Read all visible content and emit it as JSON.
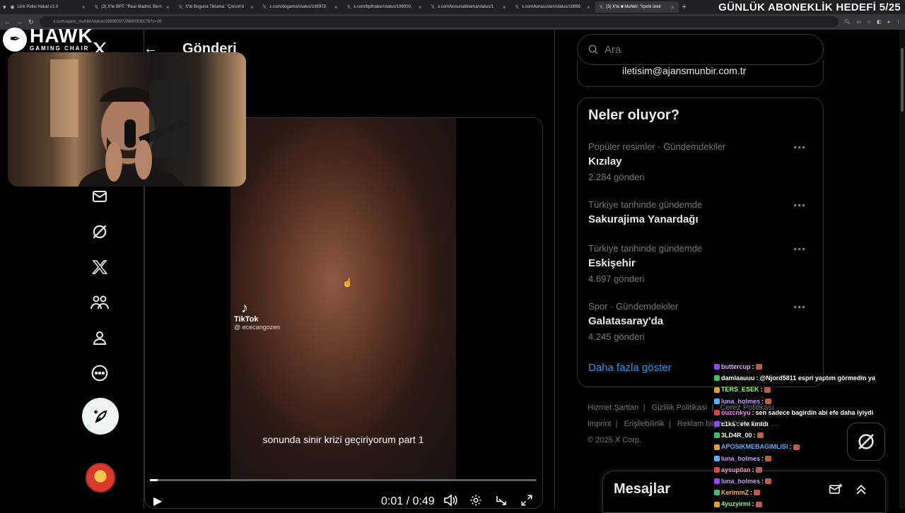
{
  "browser": {
    "tabs": [
      {
        "label": "Link Polisi Hakat v1.0",
        "active": false
      },
      {
        "label": "(3) X'te BPT: \"Real Madrid, Bern",
        "active": false
      },
      {
        "label": "X'te Boguna Tiklama: \"Çorum'd",
        "active": false
      },
      {
        "label": "x.com/dogamsi/status/198973",
        "active": false
      },
      {
        "label": "x.com/bpthaber/status/199000",
        "active": false
      },
      {
        "label": "x.com/bosunatiklama/status/1",
        "active": false
      },
      {
        "label": "x.com/kerasusien/status/19899",
        "active": false
      },
      {
        "label": "(3) X'te ■ Muhbir: \"İçerik üreti",
        "active": true
      }
    ],
    "url": "x.com/ajans_muhbir/status/1989839726690308176?s=20"
  },
  "overlay": {
    "goal": "GÜNLÜK ABONEKLİK HEDEFİ 5/25",
    "logo_big": "HAWK",
    "logo_small": "GAMING CHAIR"
  },
  "post": {
    "title": "Gönderi",
    "video": {
      "caption": "sonunda sinir krizi geçiriyorum part 1",
      "tiktok_label": "TikTok",
      "tiktok_handle": "@ ececangozen",
      "time": "0:01 / 0:49",
      "progress": 0.02
    }
  },
  "sidebar": {
    "search_placeholder": "Ara",
    "contact": "iletisim@ajansmunbir.com.tr",
    "trends_title": "Neler oluyor?",
    "trends": [
      {
        "meta": "Popüler resimler · Gündemdekiler",
        "name": "Kızılay",
        "count": "2.284 gönderi"
      },
      {
        "meta": "Türkiye tarihinde gündemde",
        "name": "Sakurajima Yanardağı",
        "count": ""
      },
      {
        "meta": "Türkiye tarihinde gündemde",
        "name": "Eskişehir",
        "count": "4.697 gönderi"
      },
      {
        "meta": "Spor · Gündemdekiler",
        "name": "Galatasaray'da",
        "count": "4.245 gönderi"
      }
    ],
    "show_more": "Daha fazla göster",
    "footer": {
      "terms": "Hizmet Şartları",
      "privacy": "Gizlilik Politikası",
      "cookies": "Çerez Politikası",
      "imprint": "Imprint",
      "accessibility": "Erişilebilirlik",
      "ads": "Reklam bilgisi",
      "more": "Daha fazla …",
      "copyright": "© 2025 X Corp."
    },
    "messages_title": "Mesajlar"
  },
  "chat": [
    {
      "user": "buttercup",
      "color": "#d9a7ff",
      "text": ""
    },
    {
      "user": "damlaauuu",
      "color": "#ffffff",
      "text": "@Njord5811 espri yaptım görmedin ya"
    },
    {
      "user": "TERS_ESEK",
      "color": "#9cff5a",
      "text": ""
    },
    {
      "user": "luna_holmes",
      "color": "#c79bff",
      "text": ""
    },
    {
      "user": "ouzcnkyu",
      "color": "#ff8cf0",
      "text": "sen sadece bagirdin abi efe daha iyiydi"
    },
    {
      "user": "c1ks",
      "color": "#ffffff",
      "text": "efe kırıldı"
    },
    {
      "user": "3LD4R_00",
      "color": "#ffffff",
      "text": ""
    },
    {
      "user": "APOSIKMEBAGIMLISI",
      "color": "#5ab0ff",
      "text": ""
    },
    {
      "user": "luna_holmes",
      "color": "#c79bff",
      "text": ""
    },
    {
      "user": "aysupilan",
      "color": "#ff9ad5",
      "text": ""
    },
    {
      "user": "luna_holmes",
      "color": "#c79bff",
      "text": ""
    },
    {
      "user": "KerimmZ",
      "color": "#ffb24a",
      "text": ""
    },
    {
      "user": "4yuzyirmi",
      "color": "#7dff7d",
      "text": ""
    }
  ]
}
